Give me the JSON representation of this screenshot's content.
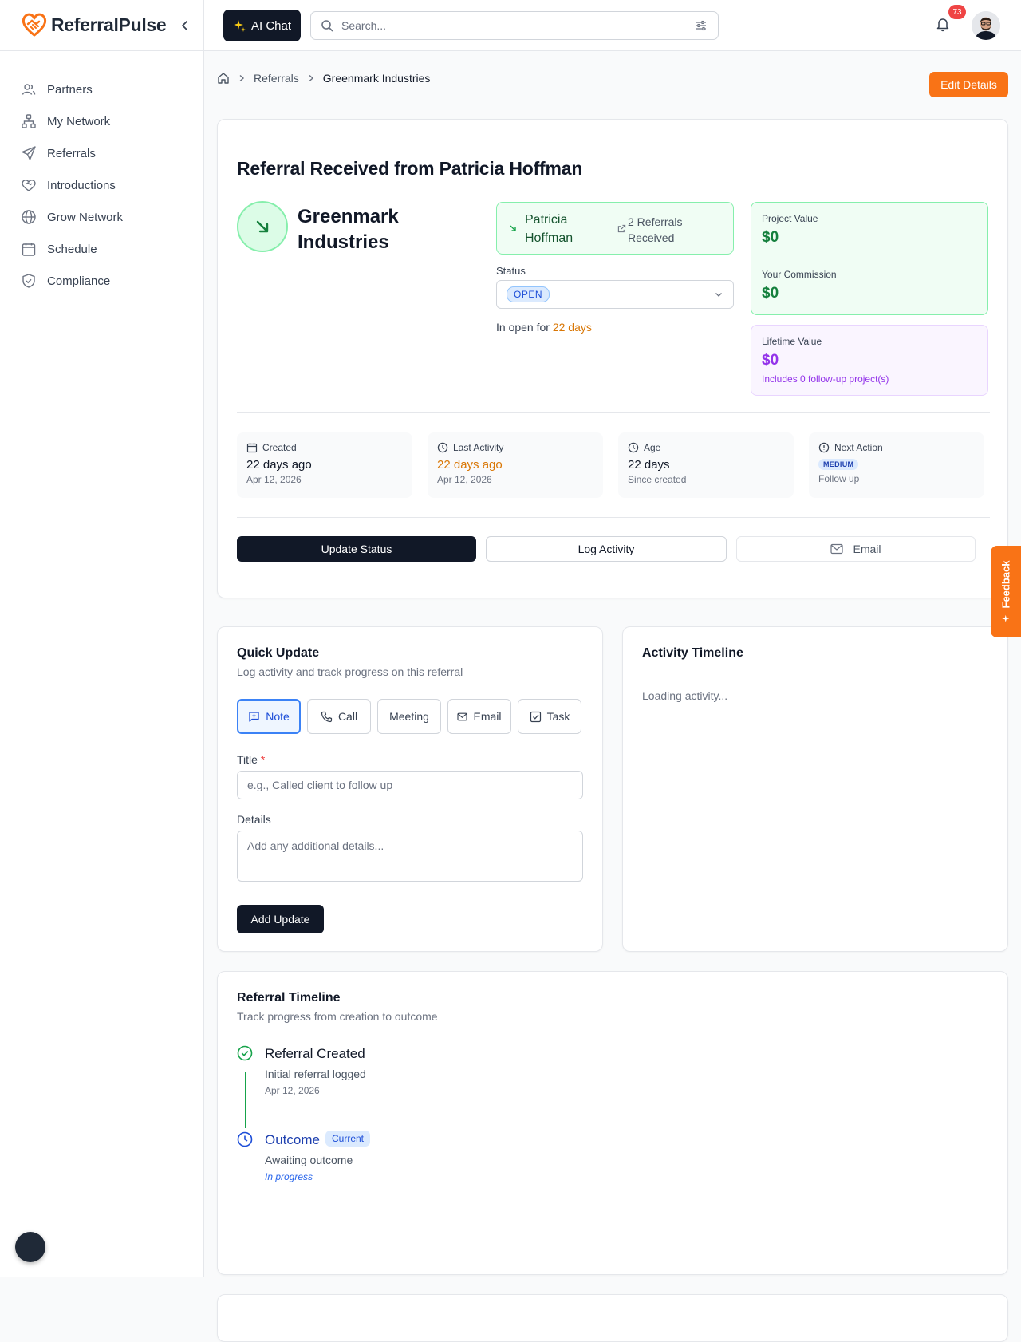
{
  "app": {
    "name": "ReferralPulse",
    "ai_chat_label": "AI Chat",
    "search_placeholder": "Search...",
    "notification_count": "73"
  },
  "sidebar": {
    "items": [
      {
        "label": "Partners",
        "icon": "users-icon"
      },
      {
        "label": "My Network",
        "icon": "network-icon"
      },
      {
        "label": "Referrals",
        "icon": "send-icon"
      },
      {
        "label": "Introductions",
        "icon": "handshake-icon"
      },
      {
        "label": "Grow Network",
        "icon": "globe-icon"
      },
      {
        "label": "Schedule",
        "icon": "calendar-icon"
      },
      {
        "label": "Compliance",
        "icon": "shield-icon"
      }
    ]
  },
  "breadcrumb": {
    "items": [
      "Referrals",
      "Greenmark Industries"
    ]
  },
  "actions": {
    "edit_details": "Edit Details"
  },
  "referral": {
    "title": "Referral Received from Patricia Hoffman",
    "company": "Greenmark Industries",
    "partner_name": "Patricia Hoffman",
    "partner_referrals": "2 Referrals Received",
    "status_label": "Status",
    "status_value": "OPEN",
    "open_for_prefix": "In open for",
    "open_for_value": "22 days",
    "project_value_label": "Project Value",
    "project_value": "$0",
    "commission_label": "Your Commission",
    "commission_value": "$0",
    "lifetime_label": "Lifetime Value",
    "lifetime_value": "$0",
    "lifetime_note": "Includes 0 follow-up project(s)"
  },
  "stats": {
    "created": {
      "label": "Created",
      "value": "22 days ago",
      "sub": "Apr 12, 2026"
    },
    "last_activity": {
      "label": "Last Activity",
      "value": "22 days ago",
      "sub": "Apr 12, 2026"
    },
    "age": {
      "label": "Age",
      "value": "22 days",
      "sub": "Since created"
    },
    "next_action": {
      "label": "Next Action",
      "priority": "MEDIUM",
      "sub": "Follow up"
    }
  },
  "buttons": {
    "update_status": "Update Status",
    "log_activity": "Log Activity",
    "email": "Email"
  },
  "quick_update": {
    "title": "Quick Update",
    "subtitle": "Log activity and track progress on this referral",
    "types": [
      "Note",
      "Call",
      "Meeting",
      "Email",
      "Task"
    ],
    "title_label": "Title",
    "title_required": "*",
    "title_placeholder": "e.g., Called client to follow up",
    "details_label": "Details",
    "details_placeholder": "Add any additional details...",
    "submit": "Add Update"
  },
  "activity": {
    "title": "Activity Timeline",
    "loading": "Loading activity..."
  },
  "referral_timeline": {
    "title": "Referral Timeline",
    "subtitle": "Track progress from creation to outcome",
    "steps": [
      {
        "title": "Referral Created",
        "desc": "Initial referral logged",
        "date": "Apr 12, 2026"
      },
      {
        "title": "Outcome",
        "badge": "Current",
        "desc": "Awaiting outcome",
        "date": "In progress"
      }
    ]
  },
  "feedback": {
    "label": "Feedback"
  },
  "colors": {
    "brand_orange": "#f97316",
    "dark": "#111827",
    "success_green": "#15803d",
    "purple": "#9333ea",
    "warning_orange": "#d97706"
  }
}
